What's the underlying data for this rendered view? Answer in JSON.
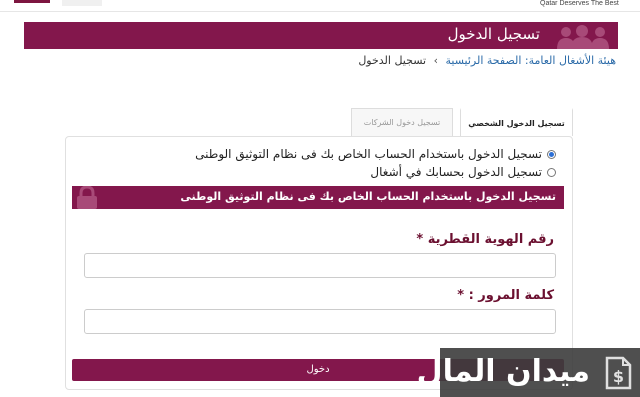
{
  "header": {
    "slogan": "Qatar Deserves The Best"
  },
  "page": {
    "title": "تسجيل الدخول"
  },
  "breadcrumb": {
    "authority": "هيئة الأشغال العامة",
    "home": ": الصفحة الرئيسية",
    "separator": "›",
    "current": "تسجيل الدخول"
  },
  "tabs": [
    {
      "label": "تسجيل الدخول الشخصي",
      "active": true
    },
    {
      "label": "تسجيل دخول الشركات",
      "active": false
    }
  ],
  "login_options": [
    {
      "label": "تسجيل الدخول باستخدام الحساب الخاص بك فى نظام التوثيق الوطنى",
      "selected": true
    },
    {
      "label": "تسجيل الدخول بحسابك في أشغال",
      "selected": false
    }
  ],
  "section": {
    "title": "تسجيل الدخول باستخدام الحساب الخاص بك فى نظام التوثيق الوطنى"
  },
  "form": {
    "id_label": "رقم الهوية القطرية",
    "id_required": "*",
    "id_value": "",
    "password_label": "كلمة المرور :",
    "password_required": "*",
    "password_value": "",
    "submit_label": "دخول"
  },
  "watermark": {
    "text": "ميدان المال",
    "icon": "dollar-document-icon"
  },
  "colors": {
    "brand": "#83174c",
    "link": "#2a6aa8",
    "label": "#6b1030"
  }
}
